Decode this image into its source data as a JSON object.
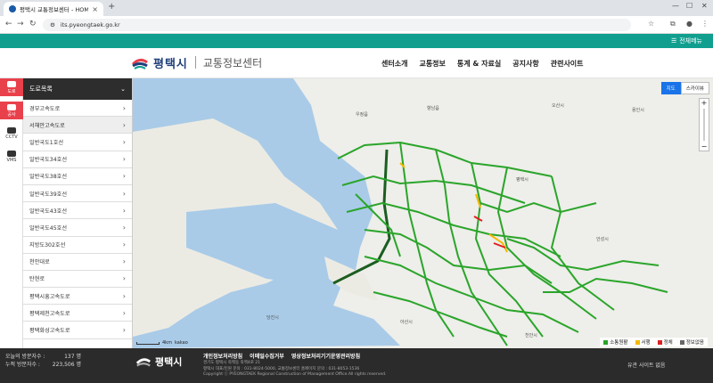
{
  "browser": {
    "tab_title": "평택시 교통정보센터 - HOME",
    "url": "its.pyeongtaek.go.kr"
  },
  "topbar": {
    "all_menu": "전체메뉴"
  },
  "header": {
    "city_name": "평택시",
    "center_name": "교통정보센터",
    "nav": [
      "센터소개",
      "교통정보",
      "통계 & 자료실",
      "공지사항",
      "관련사이트"
    ]
  },
  "rail": [
    {
      "label": "도로",
      "icon": "road-icon",
      "active": true
    },
    {
      "label": "공사",
      "icon": "construction-icon",
      "active": false
    },
    {
      "label": "CCTV",
      "icon": "cctv-icon",
      "active": false
    },
    {
      "label": "VMS",
      "icon": "vms-icon",
      "active": false
    }
  ],
  "roadlist": {
    "title": "도로목록",
    "items": [
      "경부고속도로",
      "서해안고속도로",
      "일반국도1호선",
      "일반국도34호선",
      "일반국도38호선",
      "일반국도39호선",
      "일반국도43호선",
      "일반국도45호선",
      "지방도302호선",
      "천안대로",
      "탄현로",
      "평택시흥고속도로",
      "평택제천고속도로",
      "평택화성고속도로"
    ],
    "selected_index": 1
  },
  "map": {
    "maptype": [
      "지도",
      "스카이뷰"
    ],
    "active_maptype": "지도",
    "scale_label": "4km",
    "attribution": "kakao",
    "legend": [
      {
        "label": "소통원활",
        "color": "#2aa52a"
      },
      {
        "label": "서행",
        "color": "#f5b800"
      },
      {
        "label": "정체",
        "color": "#e02020"
      },
      {
        "label": "정보없음",
        "color": "#666666"
      }
    ]
  },
  "footer": {
    "today_label": "오늘의 방문자수 :",
    "today_value": "137 명",
    "total_label": "누적 방문자수 :",
    "total_value": "223,506 명",
    "city_name": "평택시",
    "links": [
      "개인정보처리방침",
      "이메일수집거부",
      "영상정보처리기기운영관리방침"
    ],
    "info_line1": "경기도 평택시 죽백동 죽백4로 21",
    "info_line2": "평택시 대표/민원 문의 : 031-8024-5000, 교통정보센터 홈페이지 문의 : 031-8053-1536",
    "info_line3": "Copyright ⓒ PYEONGTAEK Regional Construction of Management Office.All rights reserved.",
    "site_select": "유관 사이트 없음"
  }
}
